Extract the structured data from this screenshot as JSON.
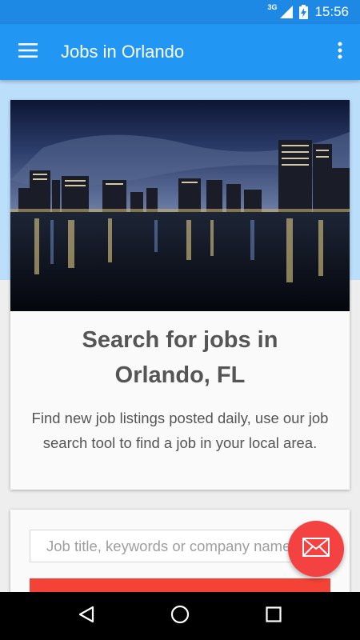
{
  "status_bar": {
    "network": "3G",
    "time": "15:56"
  },
  "app_bar": {
    "title": "Jobs in Orlando",
    "menu_icon": "hamburger-menu-icon",
    "overflow_icon": "more-vertical-icon"
  },
  "hero_card": {
    "image_subject": "Orlando skyline at night reflected in a lake",
    "title": "Search for jobs in Orlando, FL",
    "description": "Find new job listings posted daily, use our job search tool to find a job in your local area."
  },
  "search_card": {
    "input_placeholder": "Job title, keywords or company name",
    "input_value": "",
    "button_label": ""
  },
  "fab": {
    "icon": "envelope-icon"
  },
  "nav_bar": {
    "back_icon": "back-triangle-icon",
    "home_icon": "home-circle-icon",
    "recents_icon": "recents-square-icon"
  },
  "colors": {
    "status_bar": "#1e88e5",
    "app_bar": "#2196f3",
    "hero_band": "#bbdefb",
    "fab": "#f44242",
    "search_button": "#f44336"
  }
}
